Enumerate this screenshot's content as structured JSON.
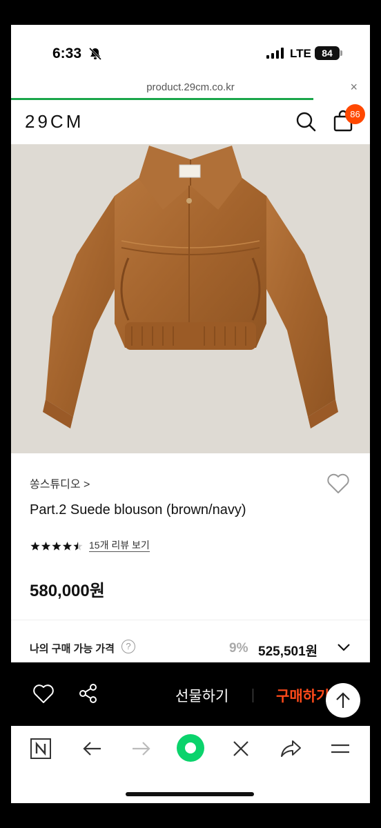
{
  "status": {
    "time": "6:33",
    "network": "LTE",
    "battery": "84"
  },
  "browser": {
    "url": "product.29cm.co.kr",
    "close_label": "×"
  },
  "site": {
    "logo": "29CM",
    "cart_count": "86"
  },
  "product": {
    "brand": "쏭스튜디오 >",
    "title": "Part.2 Suede blouson (brown/navy)",
    "rating": 4.5,
    "rating_max": 5,
    "review_link": "15개 리뷰 보기",
    "price": "580,000원",
    "my_price_label": "나의 구매 가능 가격",
    "help_icon": "?",
    "discount": "9%",
    "final_price": "525,501원"
  },
  "actions": {
    "gift": "선물하기",
    "buy": "구매하기"
  },
  "icons": {
    "bell": "bell-slash-icon",
    "search": "search-icon",
    "bag": "shopping-bag-icon",
    "heart": "heart-icon",
    "share": "share-icon",
    "top": "arrow-up-icon",
    "naver": "naver-n-icon",
    "back": "arrow-left-icon",
    "forward": "arrow-right-icon",
    "close": "close-icon",
    "menu": "menu-icon"
  },
  "colors": {
    "accent": "#ff4800",
    "buy": "#ff4a1a",
    "progress": "#1aa64a",
    "green_button": "#0bd36c"
  }
}
